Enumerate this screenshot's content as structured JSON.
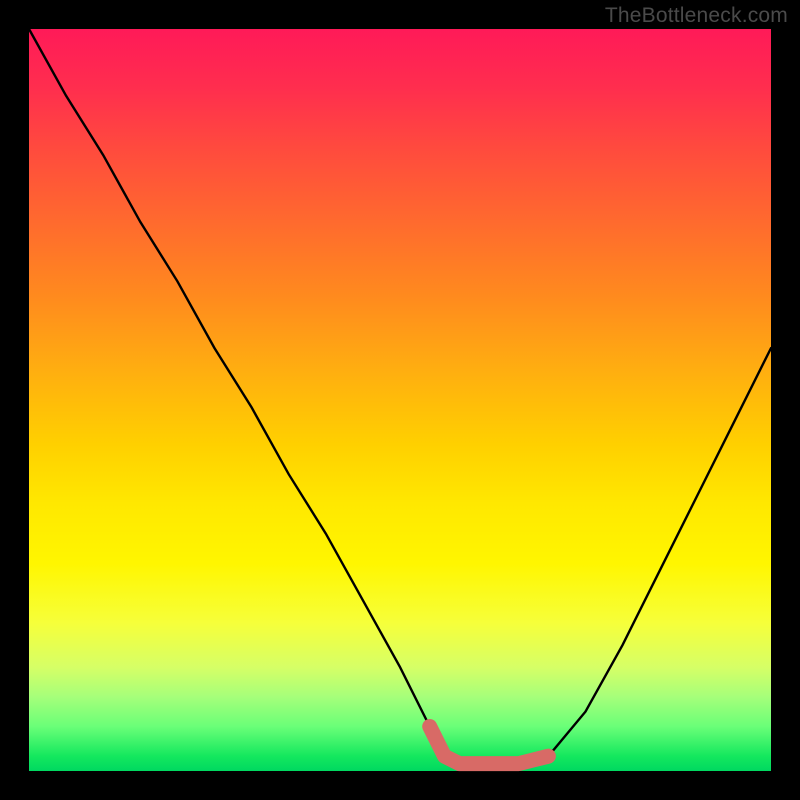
{
  "watermark": "TheBottleneck.com",
  "chart_data": {
    "type": "line",
    "title": "",
    "xlabel": "",
    "ylabel": "",
    "xlim": [
      0,
      100
    ],
    "ylim": [
      0,
      100
    ],
    "series": [
      {
        "name": "bottleneck-curve",
        "x": [
          0,
          5,
          10,
          15,
          20,
          25,
          30,
          35,
          40,
          45,
          50,
          54,
          56,
          58,
          60,
          63,
          66,
          70,
          75,
          80,
          85,
          90,
          95,
          100
        ],
        "y": [
          100,
          91,
          83,
          74,
          66,
          57,
          49,
          40,
          32,
          23,
          14,
          6,
          2,
          1,
          1,
          1,
          1,
          2,
          8,
          17,
          27,
          37,
          47,
          57
        ]
      },
      {
        "name": "highlight-segment",
        "x": [
          54,
          56,
          58,
          60,
          63,
          66,
          68,
          70
        ],
        "y": [
          6,
          2,
          1,
          1,
          1,
          1,
          1.5,
          2
        ]
      }
    ]
  }
}
